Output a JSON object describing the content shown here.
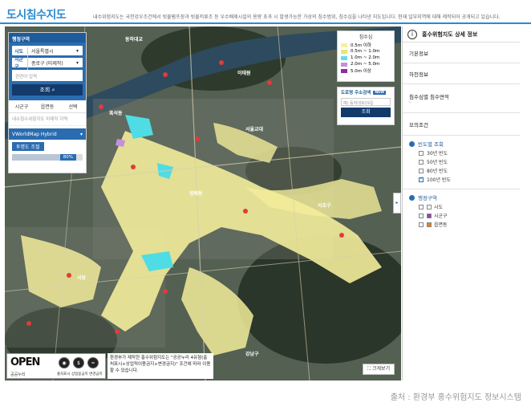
{
  "page": {
    "title": "도시침수지도",
    "description": "내수위험지도는 국한강우조건에서 빗물펌프장과 빗물저류조 등 우수배제시설의 용량 초과 시 발생가능한 가상의 침수범위, 침수심을 나타낸 지도입니다. 현재 일부지역에 대해 제작되어 공개되고 있습니다.",
    "source": "출처 : 환경부 홍수위험지도 정보시스템"
  },
  "search_panel": {
    "header": "행정구역",
    "sido_label": "시도",
    "sido_value": "서울특별시",
    "sigungu_label": "시군구",
    "sigungu_value": "종로구 (미제작)",
    "keyword_placeholder": "관련어 입력",
    "search_button": "조회",
    "tabs": [
      "시군구",
      "읍면동",
      "선택"
    ],
    "result_text": "내수침수위험지도 미제작 지역",
    "basemap": "VWorldMap Hybrid",
    "opacity_label": "투명도 조절",
    "opacity_value": "80%",
    "opacity_fraction": 0.8
  },
  "legend": {
    "title": "침수심",
    "items": [
      {
        "label": "0.5m 이하",
        "color": "#f5f0a8"
      },
      {
        "label": "0.5m ~ 1.0m",
        "color": "#e6e86a"
      },
      {
        "label": "1.0m ~ 2.0m",
        "color": "#5ee0e6"
      },
      {
        "label": "2.0m ~ 5.0m",
        "color": "#c38fe0"
      },
      {
        "label": "5.0m 이상",
        "color": "#8b2f9e"
      }
    ]
  },
  "address_search": {
    "title": "도로명 주소검색",
    "tag": "NEW",
    "placeholder": "예) 동작대로29길",
    "button": "조회"
  },
  "map_labels": [
    {
      "text": "동작대교"
    },
    {
      "text": "이태원"
    },
    {
      "text": "흑석동"
    },
    {
      "text": "서울교대"
    },
    {
      "text": "방배동"
    },
    {
      "text": "사당"
    },
    {
      "text": "서초구"
    },
    {
      "text": "강남구"
    }
  ],
  "open_logo": {
    "text": "OPEN",
    "sub": "공공누리",
    "badge_caption": "출처표시 상업용금지 변경금지"
  },
  "notice": "환경부가 제작한 홍수위험지도는 \"공공누리 4유형(출처표시+상업적이용금지+변경금지)\" 조건에 따라 이용할 수 있습니다.",
  "enlarge_button": "크게보기",
  "detail_panel": {
    "title": "홍수위험지도 상세 정보",
    "sections": [
      {
        "label": "기본정보"
      },
      {
        "label": "하천정보"
      },
      {
        "label": "침수심별 침수면적",
        "sub": "-"
      },
      {
        "label": "모의조건"
      }
    ],
    "frequency_title": "빈도별 조회",
    "frequencies": [
      {
        "label": "30년 빈도",
        "checked": false
      },
      {
        "label": "50년 빈도",
        "checked": false
      },
      {
        "label": "80년 빈도",
        "checked": false
      },
      {
        "label": "100년 빈도",
        "checked": true
      }
    ],
    "admin_title": "행정구역",
    "admin_items": [
      {
        "label": "시도",
        "checked": false,
        "color": "#ffffff"
      },
      {
        "label": "시군구",
        "checked": false,
        "color": "#8e44ad"
      },
      {
        "label": "읍면동",
        "checked": false,
        "color": "#e67e22"
      }
    ]
  }
}
